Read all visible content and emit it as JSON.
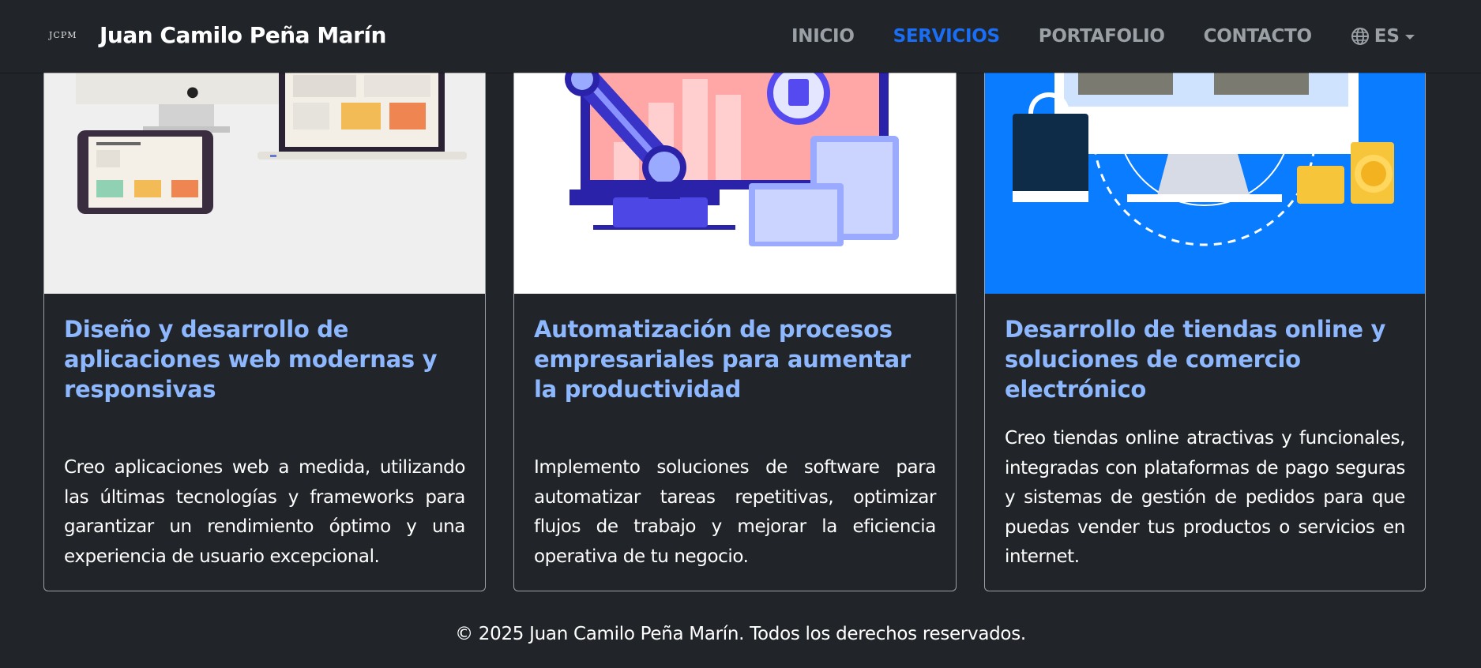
{
  "header": {
    "logo": "JCPM",
    "brand": "Juan Camilo Peña Marín",
    "nav": [
      "INICIO",
      "SERVICIOS",
      "PORTAFOLIO",
      "CONTACTO"
    ],
    "active_nav": "SERVICIOS",
    "lang": "ES",
    "lang_icon": "globe-icon"
  },
  "cards": [
    {
      "title": "Diseño y desarrollo de aplicaciones web modernas y responsivas",
      "text": "Creo aplicaciones web a medida, utilizando las últimas tecnologías y frameworks para garantizar un rendimiento óptimo y una experiencia de usuario excepcional.",
      "image": "devices-illustration"
    },
    {
      "title": "Automatización de procesos empresariales para aumentar la productividad",
      "text": "Implemento soluciones de software para automatizar tareas repetitivas, optimizar flujos de trabajo y mejorar la eficiencia operativa de tu negocio.",
      "image": "robot-arm-illustration"
    },
    {
      "title": "Desarrollo de tiendas online y soluciones de comercio electrónico",
      "text": "Creo tiendas online atractivas y funcionales, integradas con plataformas de pago seguras y sistemas de gestión de pedidos para que puedas vender tus productos o servicios en internet.",
      "image": "ecommerce-illustration"
    }
  ],
  "footer": "© 2025 Juan Camilo Peña Marín. Todos los derechos reservados.",
  "colors": {
    "background": "#212529",
    "active_link": "#1a6ef5",
    "card_title": "#8db8ff",
    "nav_link": "#9aa0a6",
    "card3_bg": "#0a7cff"
  }
}
